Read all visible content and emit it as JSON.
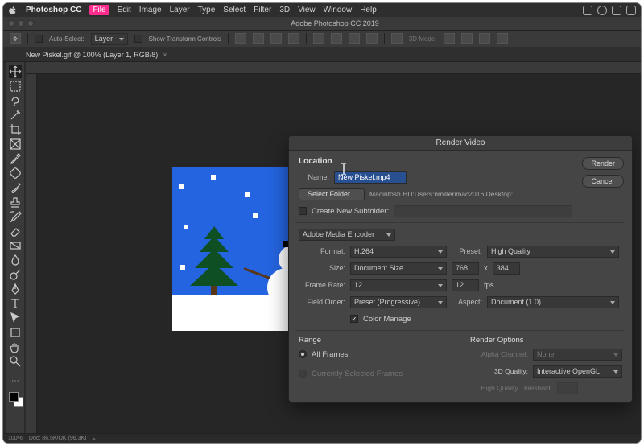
{
  "mac_menubar": {
    "app": "Photoshop CC",
    "items": [
      "File",
      "Edit",
      "Image",
      "Layer",
      "Type",
      "Select",
      "Filter",
      "3D",
      "View",
      "Window",
      "Help"
    ]
  },
  "window": {
    "title": "Adobe Photoshop CC 2019"
  },
  "options_bar": {
    "auto_select": "Auto-Select:",
    "auto_select_value": "Layer",
    "transform": "Show Transform Controls",
    "mode_3d": "3D Mode:"
  },
  "doc_tab": "New Piskel.gif @ 100% (Layer 1, RGB/8)",
  "statusbar": {
    "zoom": "100%",
    "doc": "Doc: 86.5K/OK (96.3K)"
  },
  "dialog": {
    "title": "Render Video",
    "buttons": {
      "render": "Render",
      "cancel": "Cancel"
    },
    "location": {
      "header": "Location",
      "name_label": "Name:",
      "name_value": "New Piskel.mp4",
      "select_folder": "Select Folder...",
      "folder_path": "Macintosh HD:Users:nmillerimac2016:Desktop:",
      "create_subfolder": "Create New Subfolder:"
    },
    "encoder": {
      "encoder": "Adobe Media Encoder",
      "format_label": "Format:",
      "format_value": "H.264",
      "preset_label": "Preset:",
      "preset_value": "High Quality",
      "size_label": "Size:",
      "size_value": "Document Size",
      "width": "768",
      "x": "x",
      "height": "384",
      "frame_rate_label": "Frame Rate:",
      "frame_rate_sel": "12",
      "frame_rate_val": "12",
      "fps": "fps",
      "field_order_label": "Field Order:",
      "field_order_value": "Preset (Progressive)",
      "aspect_label": "Aspect:",
      "aspect_value": "Document (1.0)",
      "color_manage": "Color Manage"
    },
    "range": {
      "header": "Range",
      "all_frames": "All Frames",
      "selected_frames": "Currently Selected Frames"
    },
    "render_options": {
      "header": "Render Options",
      "alpha_label": "Alpha Channel:",
      "alpha_value": "None",
      "quality3d_label": "3D Quality:",
      "quality3d_value": "Interactive OpenGL",
      "hqt_label": "High Quality Threshold:"
    }
  }
}
